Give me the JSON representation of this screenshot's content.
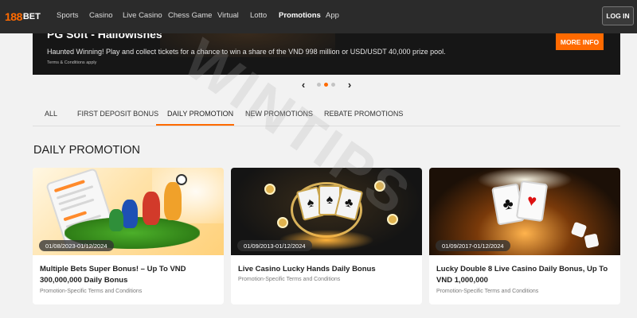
{
  "brand": {
    "logo_num": "188",
    "logo_text": "BET",
    "accent": "#ff6a00"
  },
  "nav": {
    "items": [
      {
        "label": "Sports",
        "active": false
      },
      {
        "label": "Casino",
        "active": false
      },
      {
        "label": "Live Casino",
        "active": false
      },
      {
        "label": "Chess Game",
        "active": false
      },
      {
        "label": "Virtual",
        "active": false
      },
      {
        "label": "Lotto",
        "active": false
      },
      {
        "label": "Promotions",
        "active": true
      },
      {
        "label": "App",
        "active": false
      }
    ],
    "login_label": "LOG IN"
  },
  "hero": {
    "title": "PG Soft - Hallowishes",
    "description": "Haunted Winning! Play and collect tickets for a chance to win a share of the VND 998 million or USD/USDT 40,000 prize pool.",
    "terms": "Terms & Conditions apply",
    "cta_label": "MORE INFO"
  },
  "carousel": {
    "prev_glyph": "‹",
    "next_glyph": "›",
    "slides": 3,
    "active_index": 1
  },
  "tabs": [
    {
      "label": "ALL",
      "active": false
    },
    {
      "label": "FIRST DEPOSIT BONUS",
      "active": false
    },
    {
      "label": "DAILY PROMOTION",
      "active": true
    },
    {
      "label": "NEW PROMOTIONS",
      "active": false
    },
    {
      "label": "REBATE PROMOTIONS",
      "active": false
    }
  ],
  "section": {
    "title": "DAILY PROMOTION"
  },
  "cards": [
    {
      "date": "01/08/2023-01/12/2024",
      "title": "Multiple Bets Super Bonus! – Up To VND 300,000,000 Daily Bonus",
      "terms": "Promotion-Specific Terms and Conditions"
    },
    {
      "date": "01/09/2013-01/12/2024",
      "title": "Live Casino Lucky Hands Daily Bonus",
      "terms": "Promotion-Specific Terms and Conditions"
    },
    {
      "date": "01/09/2017-01/12/2024",
      "title": "Lucky Double 8 Live Casino Daily Bonus, Up To VND 1,000,000",
      "terms": "Promotion-Specific Terms and Conditions"
    }
  ],
  "watermark": "WINTIPS",
  "icons": {
    "prev": "chevron-left-icon",
    "next": "chevron-right-icon"
  }
}
